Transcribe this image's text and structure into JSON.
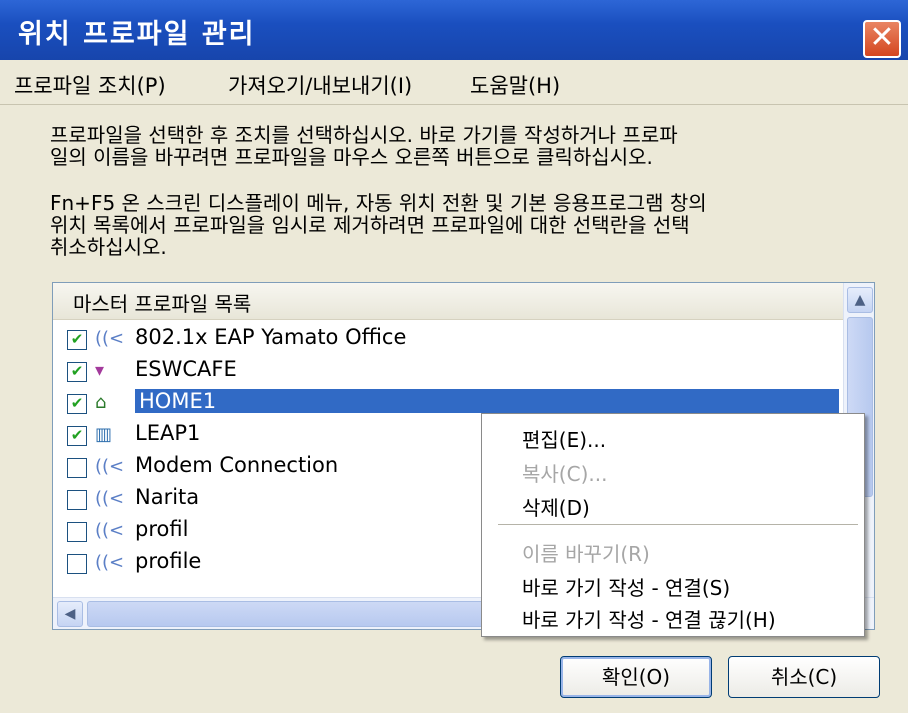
{
  "window": {
    "title": "위치 프로파일 관리",
    "close_glyph": "✕"
  },
  "menubar": {
    "items": [
      "프로파일 조치(P)",
      "가져오기/내보내기(I)",
      "도움말(H)"
    ]
  },
  "description": {
    "para1": "프로파일을 선택한 후 조치를 선택하십시오. 바로 가기를 작성하거나 프로파\n일의 이름을 바꾸려면 프로파일을 마우스 오른쪽 버튼으로 클릭하십시오.",
    "para2": "Fn+F5 온 스크린 디스플레이 메뉴, 자동 위치 전환 및 기본 응용프로그램 창의\n위치 목록에서 프로파일을 임시로 제거하려면 프로파일에 대한 선택란을 선택\n취소하십시오."
  },
  "profile_list": {
    "header": "마스터 프로파일 목록",
    "items": [
      {
        "label": "802.1x EAP Yamato Office",
        "checked": true,
        "icon": "wireless-icon",
        "glyph": "((<"
      },
      {
        "label": "ESWCAFE",
        "checked": true,
        "icon": "cup-icon",
        "glyph": "▾"
      },
      {
        "label": "HOME1",
        "checked": true,
        "icon": "home-icon",
        "glyph": "⌂"
      },
      {
        "label": "LEAP1",
        "checked": true,
        "icon": "building-icon",
        "glyph": "▥"
      },
      {
        "label": "Modem Connection",
        "checked": false,
        "icon": "wireless-icon",
        "glyph": "((<"
      },
      {
        "label": "Narita",
        "checked": false,
        "icon": "wireless-icon",
        "glyph": "((<"
      },
      {
        "label": "profil",
        "checked": false,
        "icon": "wireless-icon",
        "glyph": "((<"
      },
      {
        "label": "profile",
        "checked": false,
        "icon": "wireless-icon",
        "glyph": "((<"
      }
    ],
    "selected": "HOME1",
    "check_glyph": "✔"
  },
  "context_menu": {
    "items": [
      {
        "label": "편집(E)...",
        "enabled": true
      },
      {
        "label": "복사(C)...",
        "enabled": false
      },
      {
        "label": "삭제(D)",
        "enabled": true
      },
      {
        "label": "이름 바꾸기(R)",
        "enabled": false
      },
      {
        "label": "바로 가기 작성 - 연결(S)",
        "enabled": true
      },
      {
        "label": "바로 가기 작성 - 연결 끊기(H)",
        "enabled": true
      }
    ]
  },
  "buttons": {
    "ok": "확인(O)",
    "cancel": "취소(C)"
  },
  "scroll": {
    "up": "▲",
    "left": "◀"
  },
  "colors": {
    "titlebar": "#1a4fbf",
    "selection": "#316ac5",
    "window_bg": "#ece9d8"
  }
}
